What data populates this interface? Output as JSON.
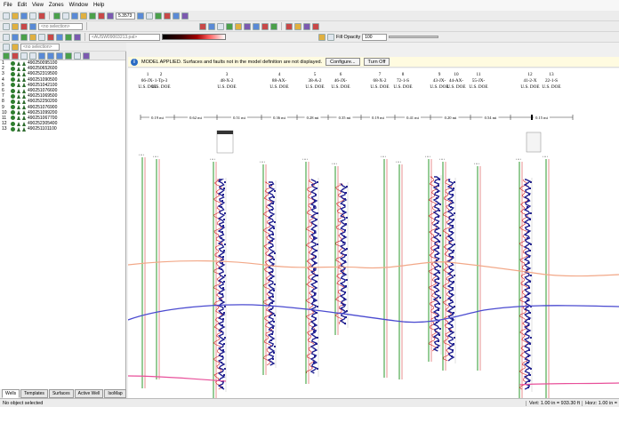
{
  "menu": [
    "File",
    "Edit",
    "View",
    "Zones",
    "Window",
    "Help"
  ],
  "toolbar": {
    "zoom_value": "5.3573",
    "selection_placeholder": "<no selection>",
    "selection_placeholder2": "<no selection>",
    "colormap_name": "<AUSW09003213.pal>",
    "fill_opacity_label": "Fill Opacity",
    "fill_opacity_value": "100"
  },
  "infobar": {
    "text": "MODEL APPLIED. Surfaces and faults not in the model definition are not displayed.",
    "configure_label": "Configure...",
    "turnoff_label": "Turn Off"
  },
  "wells": [
    {
      "num": "1",
      "id": "490250095100"
    },
    {
      "num": "2",
      "id": "490250652600"
    },
    {
      "num": "3",
      "id": "490252319500"
    },
    {
      "num": "4",
      "id": "490251090500"
    },
    {
      "num": "5",
      "id": "490251042100"
    },
    {
      "num": "6",
      "id": "490251076600"
    },
    {
      "num": "7",
      "id": "490251069500"
    },
    {
      "num": "8",
      "id": "490252250200"
    },
    {
      "num": "9",
      "id": "490251076900"
    },
    {
      "num": "10",
      "id": "490251099200"
    },
    {
      "num": "11",
      "id": "490251067700"
    },
    {
      "num": "12",
      "id": "490252305400"
    },
    {
      "num": "13",
      "id": "490251101100"
    }
  ],
  "tabs": [
    "Wells",
    "Templates",
    "Surfaces",
    "Active Well",
    "IsoMap"
  ],
  "status": {
    "left": "No object selected",
    "vert": "Vert: 1.00 in = 933.30 ft",
    "horz": "Horz: 1.00 in ="
  },
  "section": {
    "well_numbers": [
      "1",
      "2",
      "3",
      "4",
      "5",
      "6",
      "7",
      "8",
      "9",
      "10",
      "11",
      "12",
      "13"
    ],
    "well_names": [
      "66-JX-",
      "1-Tp-3",
      "48-X-2",
      "88-AX-",
      "38-A-2",
      "46-JX-",
      "68-X-2",
      "72-1-S",
      "43-JX-",
      "44-AX-",
      "55-JX-",
      "41-2-X",
      "22-1-S"
    ],
    "operators": [
      "U.S. DOE",
      "U.S. DOE",
      "U.S. DOE",
      "U.S. DOE",
      "U.S. DOE",
      "U.S. DOE",
      "U.S. DOE",
      "U.S. DOE",
      "U.S. DOE",
      "U.S. DOE",
      "U.S. DOE",
      "U.S. DOE",
      "U.S. DOE"
    ],
    "distances": [
      "0.19 mi",
      "0.62 mi",
      "0.51 mi",
      "0.36 mi",
      "0.28 mi",
      "0.35 mi",
      "0.19 mi",
      "0.41 mi",
      "0.20 mi",
      "0.54 mi",
      "0.15 mi"
    ]
  },
  "colors": {
    "surface_orange": "#f2a888",
    "surface_blue": "#4a4ad0",
    "surface_pink": "#e8509a",
    "track_green": "#2e9a2e",
    "log_red": "#d02020",
    "log_blue": "#202090"
  }
}
